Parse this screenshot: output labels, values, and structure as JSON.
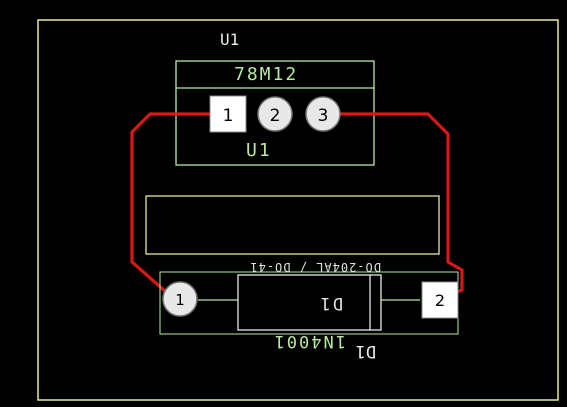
{
  "board": {
    "background": "#000000",
    "outline_color": "#e8e89a",
    "silk_top_color": "#b8e8a0",
    "silk_bottom_color": "#c8c8c8",
    "trace_color": "#d81818",
    "pad_square_color": "#ffffff",
    "pad_round_color": "#e8e8e8"
  },
  "components": {
    "u1": {
      "refdes_top": "U1",
      "value": "78M12",
      "refdes_inside": "U1",
      "pins": [
        "1",
        "2",
        "3"
      ]
    },
    "d1": {
      "value_mirrored": "1N4001",
      "refdes_mirrored": "D1",
      "refdes_inside_mirrored": "D1",
      "footprint_mirrored": "DO-204AL / DO-41",
      "pins": [
        "1",
        "2"
      ]
    }
  },
  "icons": {
    "pad_square": "square-pad-icon",
    "pad_round": "round-pad-icon"
  }
}
